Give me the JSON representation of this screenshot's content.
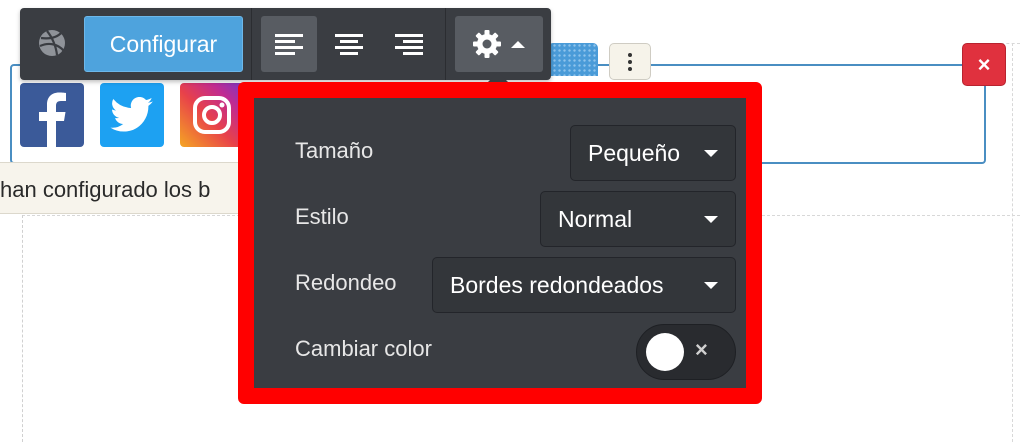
{
  "toolbar": {
    "configure_label": "Configurar",
    "logo_icon": "dribbble-ball-icon",
    "align_left_icon": "align-left-icon",
    "align_center_icon": "align-center-icon",
    "align_right_icon": "align-right-icon",
    "settings_icon": "gear-icon",
    "settings_toggle_icon": "caret-up-icon",
    "active_alignment": "left"
  },
  "block": {
    "more_icon": "vertical-dots-icon",
    "close_label": "×",
    "drag_icon": "drag-grid-icon"
  },
  "social_icons": [
    {
      "name": "facebook",
      "icon": "facebook-icon",
      "color": "#3b5a99"
    },
    {
      "name": "twitter",
      "icon": "twitter-bird-icon",
      "color": "#1da1f2"
    },
    {
      "name": "instagram",
      "icon": "instagram-icon",
      "color": "#e8414a"
    }
  ],
  "tooltip": {
    "text": "han configurado los b"
  },
  "settings": {
    "size_label": "Tamaño",
    "size_value": "Pequeño",
    "style_label": "Estilo",
    "style_value": "Normal",
    "rounding_label": "Redondeo",
    "rounding_value": "Bordes redondeados",
    "color_label": "Cambiar color",
    "color_toggle_on": false,
    "color_toggle_off_glyph": "×"
  },
  "colors": {
    "accent": "#4ea3dd",
    "toolbar_bg": "#3a3d42",
    "highlight_border": "#ff0000",
    "close_red": "#e0313e"
  }
}
